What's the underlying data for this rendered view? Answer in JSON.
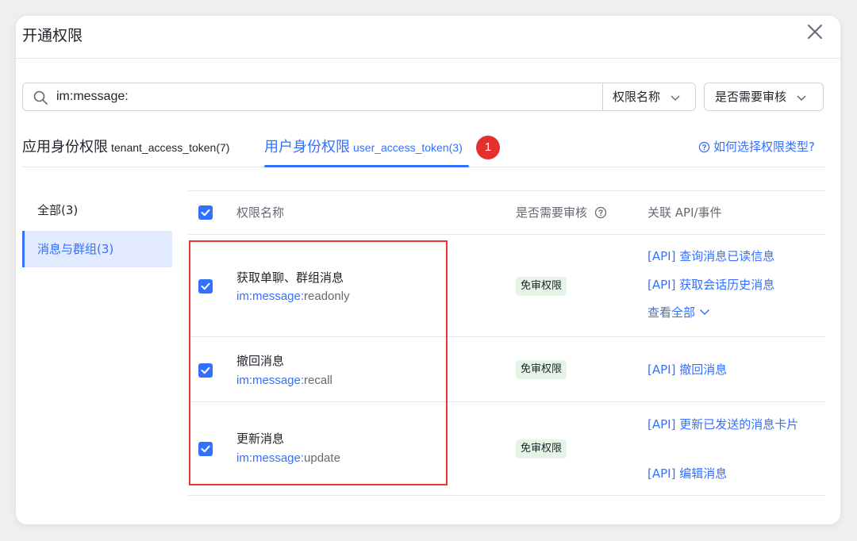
{
  "dialog": {
    "title": "开通权限"
  },
  "search": {
    "value": "im:message:",
    "field_select": "权限名称",
    "review_select": "是否需要审核"
  },
  "tabs": [
    {
      "label": "应用身份权限",
      "sub": "tenant_access_token(7)"
    },
    {
      "label": "用户身份权限",
      "sub": "user_access_token(3)"
    }
  ],
  "badge": "1",
  "help_link": "如何选择权限类型?",
  "sidebar": {
    "items": [
      {
        "label": "全部(3)"
      },
      {
        "label": "消息与群组(3)"
      }
    ]
  },
  "table": {
    "headers": {
      "name": "权限名称",
      "review": "是否需要审核",
      "api": "关联 API/事件"
    },
    "rows": [
      {
        "name": "获取单聊、群组消息",
        "code_prefix": "im:message:",
        "code_suffix": "readonly",
        "tag": "免审权限",
        "apis": [
          "[API] 查询消息已读信息",
          "[API] 获取会话历史消息"
        ],
        "more": "查看全部"
      },
      {
        "name": "撤回消息",
        "code_prefix": "im:message:",
        "code_suffix": "recall",
        "tag": "免审权限",
        "apis": [
          "[API] 撤回消息"
        ]
      },
      {
        "name": "更新消息",
        "code_prefix": "im:message:",
        "code_suffix": "update",
        "tag": "免审权限",
        "apis": [
          "[API] 更新已发送的消息卡片",
          "[API] 编辑消息"
        ]
      }
    ]
  },
  "colors": {
    "accent": "#3370ff",
    "highlight": "#e53935",
    "tag_bg": "#e4f5e7",
    "badge": "#e5312e"
  }
}
